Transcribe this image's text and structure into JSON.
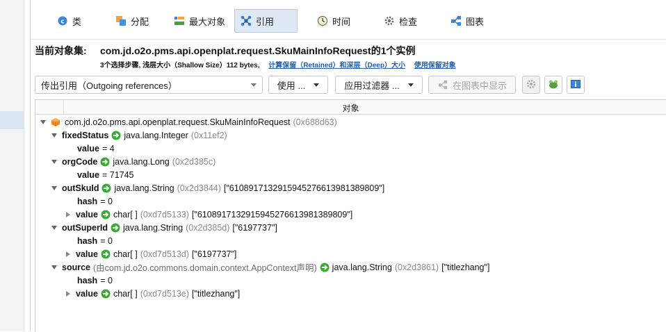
{
  "tabs": [
    {
      "label": "类",
      "icon": "class-icon"
    },
    {
      "label": "分配",
      "icon": "allocation-icon"
    },
    {
      "label": "最大对象",
      "icon": "largest-objects-icon"
    },
    {
      "label": "引用",
      "icon": "references-icon"
    },
    {
      "label": "时间",
      "icon": "time-icon"
    },
    {
      "label": "检查",
      "icon": "inspections-icon"
    },
    {
      "label": "图表",
      "icon": "graph-icon"
    }
  ],
  "header": {
    "title": "当前对象集:",
    "value": "com.jd.o2o.pms.api.openplat.request.SkuMainInfoRequest的1个实例",
    "sub_text": "3个选择步骤, 浅层大小（Shallow Size）112 bytes,",
    "link_retained": "计算保留（Retained）和深层（Deep）大小",
    "link_use_retained": "使用保留对象"
  },
  "toolbar": {
    "view_select": "传出引用（Outgoing references）",
    "use_button": "使用 ...",
    "filter_button": "应用过滤器 ...",
    "graph_button": "在图表中显示"
  },
  "table": {
    "column_header": "对象",
    "rows": [
      {
        "name": "com.jd.o2o.pms.api.openplat.request.SkuMainInfoRequest",
        "addr": "(0x688d63)"
      },
      {
        "name": "fixedStatus",
        "type": "java.lang.Integer",
        "addr": "(0x11ef2)"
      },
      {
        "name": "value",
        "eq": "= 4"
      },
      {
        "name": "orgCode",
        "type": "java.lang.Long",
        "addr": "(0x2d385c)"
      },
      {
        "name": "value",
        "eq": "= 71745"
      },
      {
        "name": "outSkuId",
        "type": "java.lang.String",
        "addr": "(0x2d3844)",
        "str": "[\"6108917132915945276613981389809\"]"
      },
      {
        "name": "hash",
        "eq": "= 0"
      },
      {
        "name": "value",
        "type": "char[ ]",
        "addr": "(0xd7d5133)",
        "str": "[\"6108917132915945276613981389809\"]"
      },
      {
        "name": "outSuperId",
        "type": "java.lang.String",
        "addr": "(0x2d385d)",
        "str": "[\"6197737\"]"
      },
      {
        "name": "hash",
        "eq": "= 0"
      },
      {
        "name": "value",
        "type": "char[ ]",
        "addr": "(0xd7d513d)",
        "str": "[\"6197737\"]"
      },
      {
        "name": "source",
        "decl": "(由com.jd.o2o.commons.domain.context.AppContext声明)",
        "type": "java.lang.String",
        "addr": "(0x2d3861)",
        "str": "[\"titlezhang\"]"
      },
      {
        "name": "hash",
        "eq": "= 0"
      },
      {
        "name": "value",
        "type": "char[ ]",
        "addr": "(0xd7d513e)",
        "str": "[\"titlezhang\"]"
      }
    ]
  },
  "colors": {
    "accent": "#1f5fae",
    "active_tab": "#dfe9f5",
    "arrow_green": "#3aa935",
    "object_orange": "#f08a1c"
  }
}
